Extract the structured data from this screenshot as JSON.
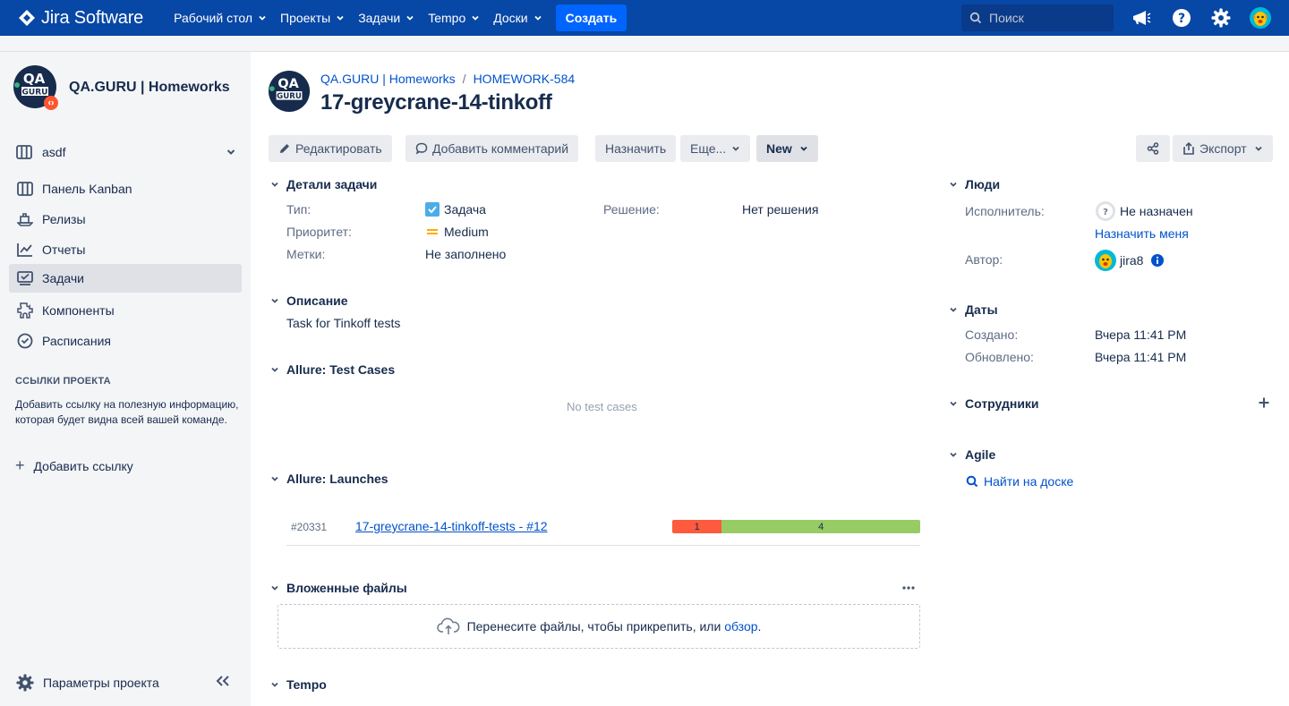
{
  "topbar": {
    "product_name": "Jira Software",
    "nav": [
      "Рабочий стол",
      "Проекты",
      "Задачи",
      "Tempo",
      "Доски"
    ],
    "create_label": "Создать",
    "search_placeholder": "Поиск",
    "colors": {
      "bar": "#0747a6",
      "create": "#0065ff"
    }
  },
  "sidebar": {
    "project_name": "QA.GURU | Homeworks",
    "board_selector": "asdf",
    "items": [
      {
        "label": "Панель Kanban",
        "icon": "board-icon"
      },
      {
        "label": "Релизы",
        "icon": "ship-icon"
      },
      {
        "label": "Отчеты",
        "icon": "graph-line-icon"
      },
      {
        "label": "Задачи",
        "icon": "issues-icon",
        "active": true
      },
      {
        "label": "Компоненты",
        "icon": "component-icon"
      },
      {
        "label": "Расписания",
        "icon": "clock-check-icon"
      }
    ],
    "links_heading": "ССЫЛКИ ПРОЕКТА",
    "links_description": "Добавить ссылку на полезную информацию, которая будет видна всей вашей команде.",
    "add_link_label": "Добавить ссылку",
    "settings_label": "Параметры проекта"
  },
  "issue": {
    "breadcrumb_project": "QA.GURU | Homeworks",
    "breadcrumb_sep": "/",
    "breadcrumb_key": "HOMEWORK-584",
    "title": "17-greycrane-14-tinkoff"
  },
  "toolbar": {
    "edit": "Редактировать",
    "comment": "Добавить комментарий",
    "assign": "Назначить",
    "more": "Еще...",
    "status": "New",
    "export": "Экспорт"
  },
  "details": {
    "heading": "Детали задачи",
    "type_label": "Тип:",
    "type_value": "Задача",
    "priority_label": "Приоритет:",
    "priority_value": "Medium",
    "labels_label": "Метки:",
    "labels_value": "Не заполнено",
    "resolution_label": "Решение:",
    "resolution_value": "Нет решения"
  },
  "description": {
    "heading": "Описание",
    "text": "Task for Tinkoff tests"
  },
  "allure_tc": {
    "heading": "Allure: Test Cases",
    "empty": "No test cases"
  },
  "allure_launches": {
    "heading": "Allure: Launches",
    "launch": {
      "id": "#20331",
      "name": "17-greycrane-14-tinkoff-tests - #12",
      "failed": 1,
      "passed": 4
    },
    "colors": {
      "failed": "#fd5a3e",
      "passed": "#97cc64"
    }
  },
  "attachments": {
    "heading": "Вложенные файлы",
    "drop_text": "Перенесите файлы, чтобы прикрепить, или",
    "browse": "обзор",
    "drop_suffix": "."
  },
  "tempo": {
    "heading": "Tempo"
  },
  "people": {
    "heading": "Люди",
    "assignee_label": "Исполнитель:",
    "assignee_value": "Не назначен",
    "assign_me": "Назначить меня",
    "reporter_label": "Автор:",
    "reporter_value": "jira8"
  },
  "dates": {
    "heading": "Даты",
    "created_label": "Создано:",
    "created_value": "Вчера 11:41 PM",
    "updated_label": "Обновлено:",
    "updated_value": "Вчера 11:41 PM"
  },
  "employees": {
    "heading": "Сотрудники"
  },
  "agile": {
    "heading": "Agile",
    "find_on_board": "Найти на доске"
  }
}
